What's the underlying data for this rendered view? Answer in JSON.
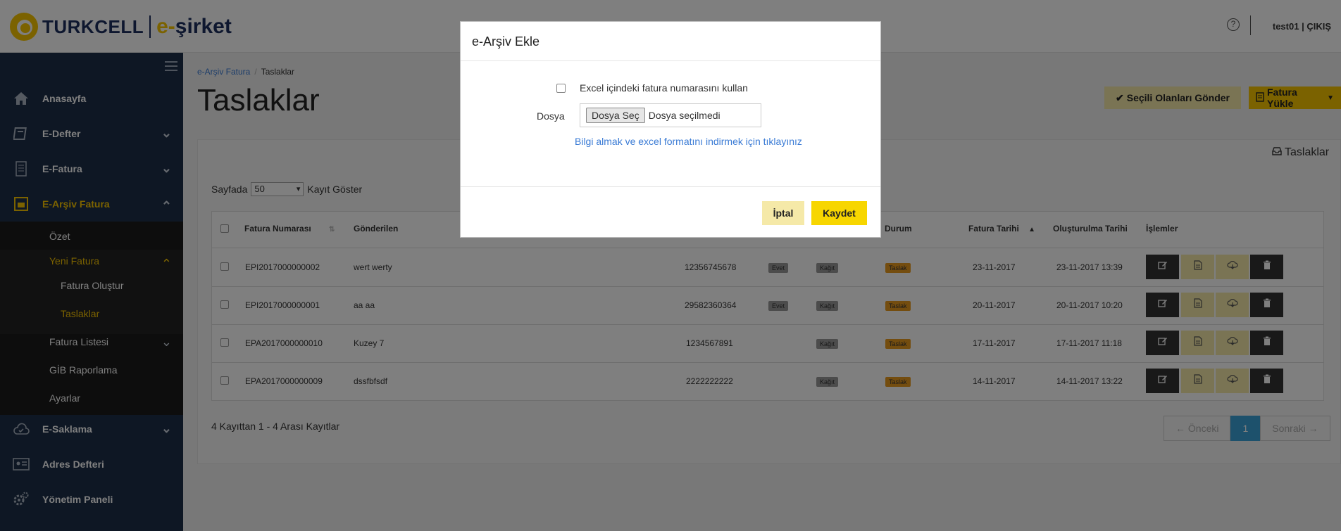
{
  "header": {
    "brand": "TURKCELL",
    "product_prefix": "e-",
    "product_name": "şirket",
    "help_icon": "?",
    "user": "test01 | ÇIKIŞ"
  },
  "sidebar": {
    "items": [
      {
        "label": "Anasayfa",
        "icon": "home-icon"
      },
      {
        "label": "E-Defter",
        "icon": "book-icon"
      },
      {
        "label": "E-Fatura",
        "icon": "receipt-icon"
      },
      {
        "label": "E-Arşiv Fatura",
        "icon": "archive-invoice-icon"
      },
      {
        "label": "E-Saklama",
        "icon": "cloud-icon"
      },
      {
        "label": "Adres Defteri",
        "icon": "address-card-icon"
      },
      {
        "label": "Yönetim Paneli",
        "icon": "gears-icon"
      }
    ],
    "sub": {
      "ozet": "Özet",
      "yeni_fatura": "Yeni Fatura",
      "fatura_olustur": "Fatura Oluştur",
      "taslaklar": "Taslaklar",
      "fatura_listesi": "Fatura Listesi",
      "gib_raporlama": "GİB Raporlama",
      "ayarlar": "Ayarlar"
    }
  },
  "breadcrumb": {
    "parent": "e-Arşiv Fatura",
    "separator": "/",
    "current": "Taslaklar"
  },
  "page_title": "Taslaklar",
  "toolbar": {
    "send_label": "Seçili Olanları Gönder",
    "upload_label": "Fatura Yükle"
  },
  "panel": {
    "title": "Taslaklar",
    "page_size_prefix": "Sayfada",
    "page_size_value": "50",
    "page_size_suffix": "Kayıt Göster"
  },
  "table": {
    "columns": {
      "fatura_no": "Fatura Numarası",
      "gonderilen": "Gönderilen",
      "durum": "Durum",
      "fatura_tarihi": "Fatura Tarihi",
      "olusturulma": "Oluşturulma Tarihi",
      "islemler": "İşlemler"
    },
    "rows": [
      {
        "no": "EPI2017000000002",
        "to": "wert werty",
        "vkn": "12356745678",
        "tag1": "Evet",
        "tag2": "Kağıt",
        "status": "Taslak",
        "date": "23-11-2017",
        "created": "23-11-2017 13:39"
      },
      {
        "no": "EPI2017000000001",
        "to": "aa aa",
        "vkn": "29582360364",
        "tag1": "Evet",
        "tag2": "Kağıt",
        "status": "Taslak",
        "date": "20-11-2017",
        "created": "20-11-2017 10:20"
      },
      {
        "no": "EPA2017000000010",
        "to": "Kuzey 7",
        "vkn": "1234567891",
        "tag1": "",
        "tag2": "Kağıt",
        "status": "Taslak",
        "date": "17-11-2017",
        "created": "17-11-2017 11:18"
      },
      {
        "no": "EPA2017000000009",
        "to": "dssfbfsdf",
        "vkn": "2222222222",
        "tag1": "",
        "tag2": "Kağıt",
        "status": "Taslak",
        "date": "14-11-2017",
        "created": "14-11-2017 13:22"
      }
    ]
  },
  "footer": {
    "count": "4 Kayıttan 1 - 4 Arası Kayıtlar",
    "prev": "← Önceki",
    "current_page": "1",
    "next": "Sonraki →"
  },
  "modal": {
    "title": "e-Arşiv Ekle",
    "checkbox_label": "Excel içindeki fatura numarasını kullan",
    "file_label": "Dosya",
    "choose_button": "Dosya Seç",
    "file_status": "Dosya seçilmedi",
    "info_link": "Bilgi almak ve excel formatını indirmek için tıklayınız",
    "cancel": "İptal",
    "save": "Kaydet"
  },
  "colors": {
    "brand_yellow": "#f7c400",
    "sidebar_bg": "#1d2f48",
    "link": "#3a7bd5"
  }
}
